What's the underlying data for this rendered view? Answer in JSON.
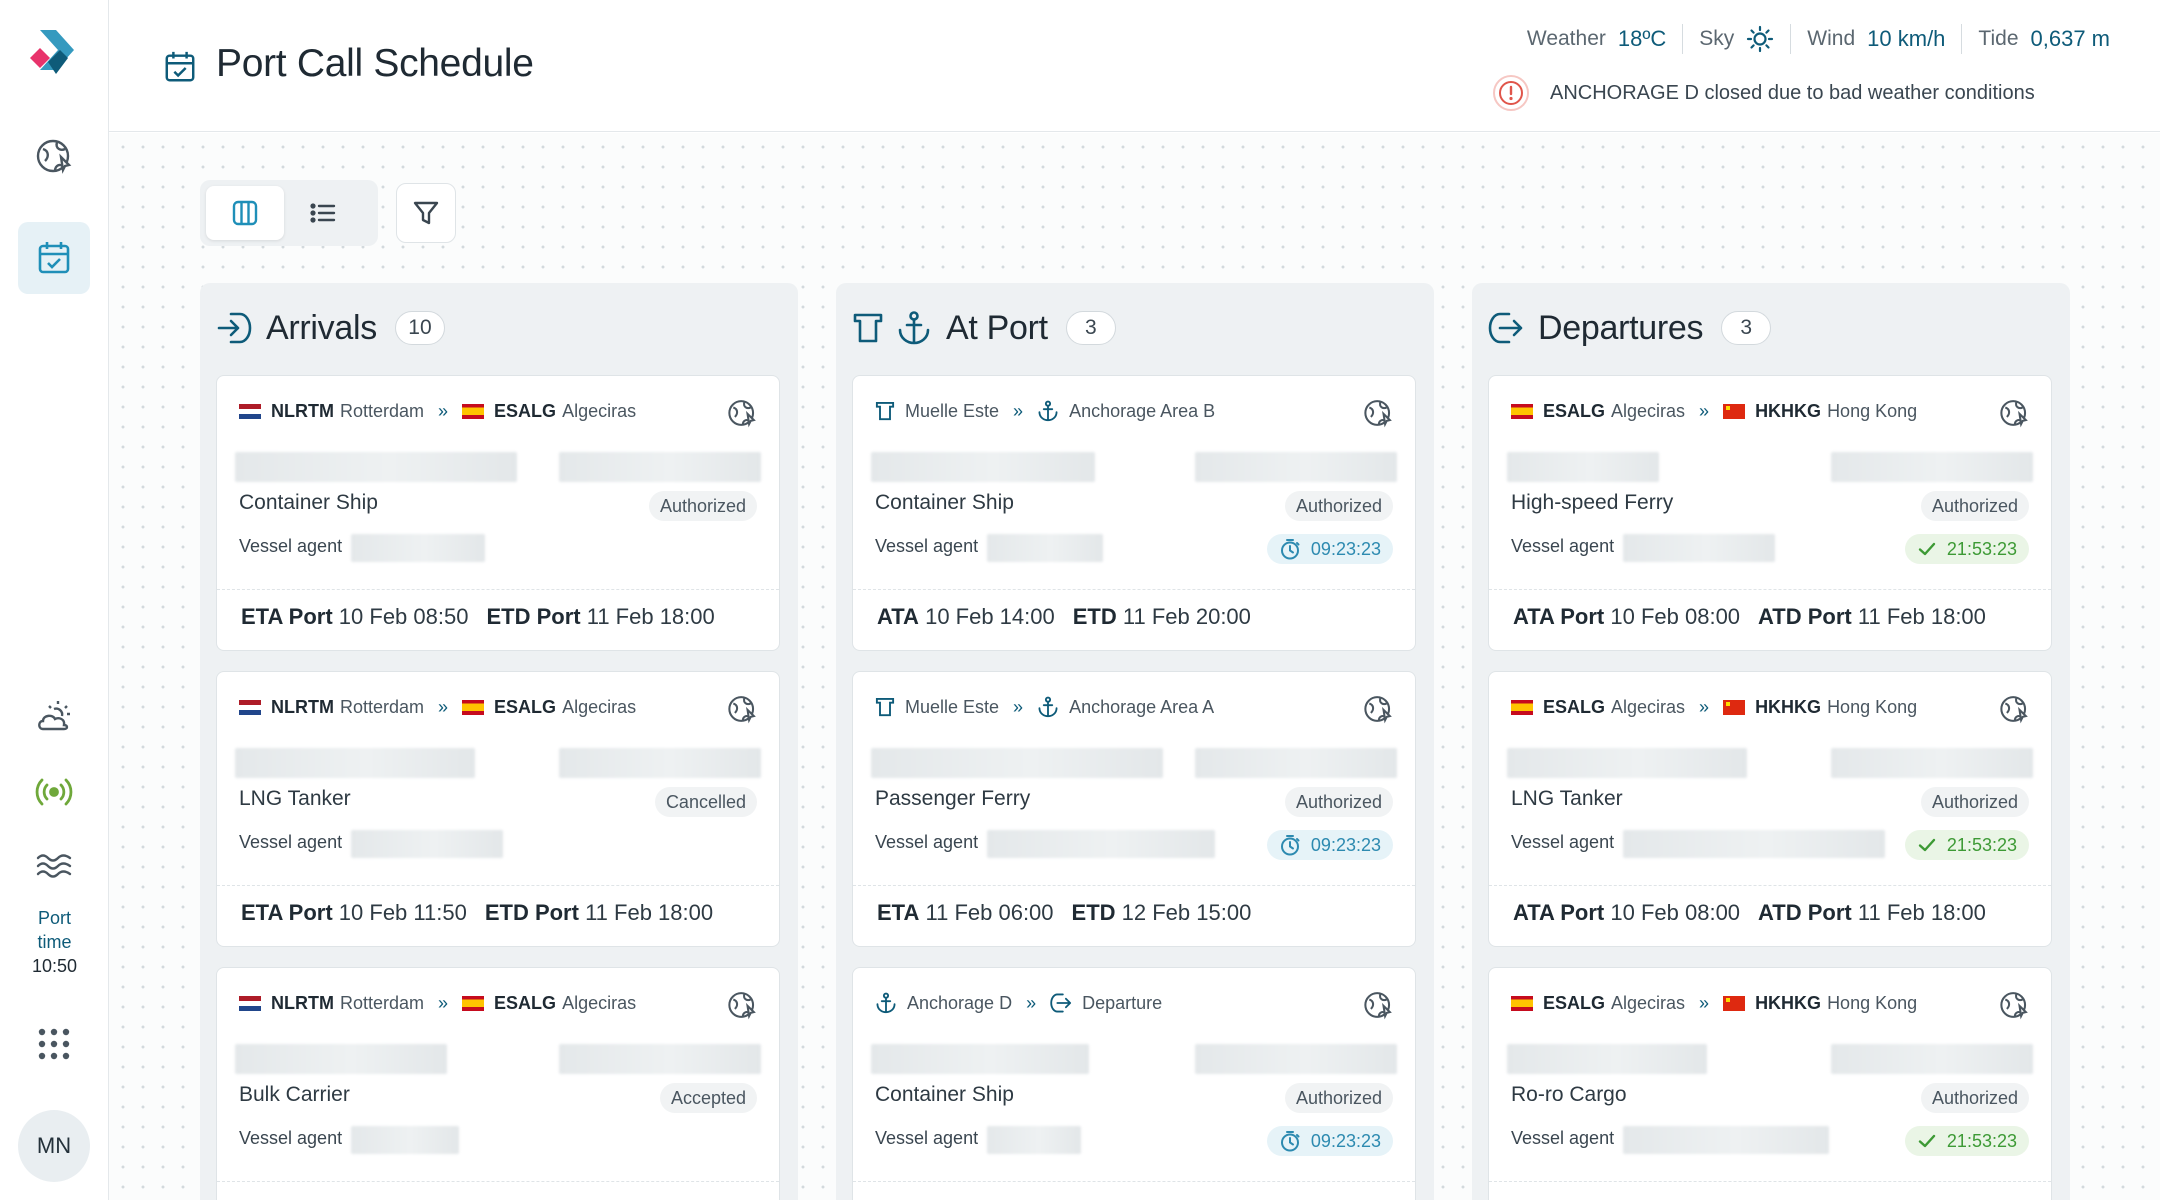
{
  "app": {
    "title": "Port Call Schedule"
  },
  "sidebar": {
    "port_time_label_1": "Port",
    "port_time_label_2": "time",
    "port_time_value": "10:50",
    "avatar_initials": "MN"
  },
  "weather": {
    "weather_label": "Weather",
    "weather_value": "18ºC",
    "sky_label": "Sky",
    "sky_icon": "sun-icon",
    "wind_label": "Wind",
    "wind_value": "10 km/h",
    "tide_label": "Tide",
    "tide_value": "0,637 m"
  },
  "alert": {
    "message": "ANCHORAGE D closed due to bad weather conditions"
  },
  "columns": [
    {
      "title": "Arrivals",
      "count": "10",
      "cards": [
        {
          "from_code": "NLRTM",
          "from_name": "Rotterdam",
          "to_code": "ESALG",
          "to_name": "Algeciras",
          "vessel_type": "Container Ship",
          "status": "Authorized",
          "agent_label": "Vessel agent",
          "t1_label": "ETA Port",
          "t1_value": "10 Feb 08:50",
          "t2_label": "ETD Port",
          "t2_value": "11 Feb 18:00"
        },
        {
          "from_code": "NLRTM",
          "from_name": "Rotterdam",
          "to_code": "ESALG",
          "to_name": "Algeciras",
          "vessel_type": "LNG Tanker",
          "status": "Cancelled",
          "agent_label": "Vessel agent",
          "t1_label": "ETA Port",
          "t1_value": "10 Feb 11:50",
          "t2_label": "ETD Port",
          "t2_value": "11 Feb 18:00"
        },
        {
          "from_code": "NLRTM",
          "from_name": "Rotterdam",
          "to_code": "ESALG",
          "to_name": "Algeciras",
          "vessel_type": "Bulk Carrier",
          "status": "Accepted",
          "agent_label": "Vessel agent"
        }
      ]
    },
    {
      "title": "At Port",
      "count": "3",
      "cards": [
        {
          "from_name": "Muelle Este",
          "to_name": "Anchorage Area B",
          "vessel_type": "Container Ship",
          "status": "Authorized",
          "agent_label": "Vessel agent",
          "timer": "09:23:23",
          "t1_label": "ATA",
          "t1_value": "10 Feb 14:00",
          "t2_label": "ETD",
          "t2_value": "11 Feb 20:00"
        },
        {
          "from_name": "Muelle Este",
          "to_name": "Anchorage Area A",
          "vessel_type": "Passenger Ferry",
          "status": "Authorized",
          "agent_label": "Vessel agent",
          "timer": "09:23:23",
          "t1_label": "ETA",
          "t1_value": "11 Feb 06:00",
          "t2_label": "ETD",
          "t2_value": "12 Feb 15:00"
        },
        {
          "from_name": "Anchorage D",
          "to_name": "Departure",
          "vessel_type": "Container Ship",
          "status": "Authorized",
          "agent_label": "Vessel agent",
          "timer": "09:23:23"
        }
      ]
    },
    {
      "title": "Departures",
      "count": "3",
      "cards": [
        {
          "from_code": "ESALG",
          "from_name": "Algeciras",
          "to_code": "HKHKG",
          "to_name": "Hong Kong",
          "vessel_type": "High-speed Ferry",
          "status": "Authorized",
          "agent_label": "Vessel agent",
          "timer": "21:53:23",
          "t1_label": "ATA Port",
          "t1_value": "10 Feb 08:00",
          "t2_label": "ATD Port",
          "t2_value": "11 Feb 18:00"
        },
        {
          "from_code": "ESALG",
          "from_name": "Algeciras",
          "to_code": "HKHKG",
          "to_name": "Hong Kong",
          "vessel_type": "LNG Tanker",
          "status": "Authorized",
          "agent_label": "Vessel agent",
          "timer": "21:53:23",
          "t1_label": "ATA Port",
          "t1_value": "10 Feb 08:00",
          "t2_label": "ATD Port",
          "t2_value": "11 Feb 18:00"
        },
        {
          "from_code": "ESALG",
          "from_name": "Algeciras",
          "to_code": "HKHKG",
          "to_name": "Hong Kong",
          "vessel_type": "Ro-ro Cargo",
          "status": "Authorized",
          "agent_label": "Vessel agent",
          "timer": "21:53:23"
        }
      ]
    }
  ],
  "colors": {
    "accent": "#0e5b79",
    "timer_blue": "#2d8ab0",
    "timer_green": "#3d9a35",
    "logo_pink": "#e8336b",
    "logo_blue": "#1f8fb8",
    "signal_green": "#6fa83a"
  }
}
